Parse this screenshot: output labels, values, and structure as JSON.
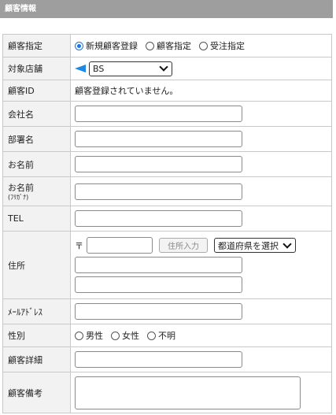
{
  "header": {
    "title": "顧客情報"
  },
  "rows": {
    "customer_spec": {
      "label": "顧客指定",
      "options": [
        "新規顧客登録",
        "顧客指定",
        "受注指定"
      ],
      "selected": "新規顧客登録"
    },
    "store": {
      "label": "対象店舗",
      "value": "BS"
    },
    "customer_id": {
      "label": "顧客ID",
      "value": "顧客登録されていません。"
    },
    "company": {
      "label": "会社名",
      "value": ""
    },
    "department": {
      "label": "部署名",
      "value": ""
    },
    "name": {
      "label": "お名前",
      "value": ""
    },
    "name_kana": {
      "label": "お名前",
      "sublabel": "(ﾌﾘｶﾞﾅ)",
      "value": ""
    },
    "tel": {
      "label": "TEL",
      "value": ""
    },
    "address": {
      "label": "住所",
      "postal_mark": "〒",
      "postal_value": "",
      "lookup_button": "住所入力",
      "prefecture": "都道府県を選択",
      "line1": "",
      "line2": ""
    },
    "email": {
      "label": "ﾒｰﾙｱﾄﾞﾚｽ",
      "value": ""
    },
    "gender": {
      "label": "性別",
      "options": [
        "男性",
        "女性",
        "不明"
      ]
    },
    "detail": {
      "label": "顧客詳細",
      "value": ""
    },
    "remarks": {
      "label": "顧客備考",
      "value": ""
    }
  },
  "colors": {
    "header_bg": "#9e9e9e",
    "label_bg": "#f2f2f2",
    "accent": "#1a73e8"
  }
}
